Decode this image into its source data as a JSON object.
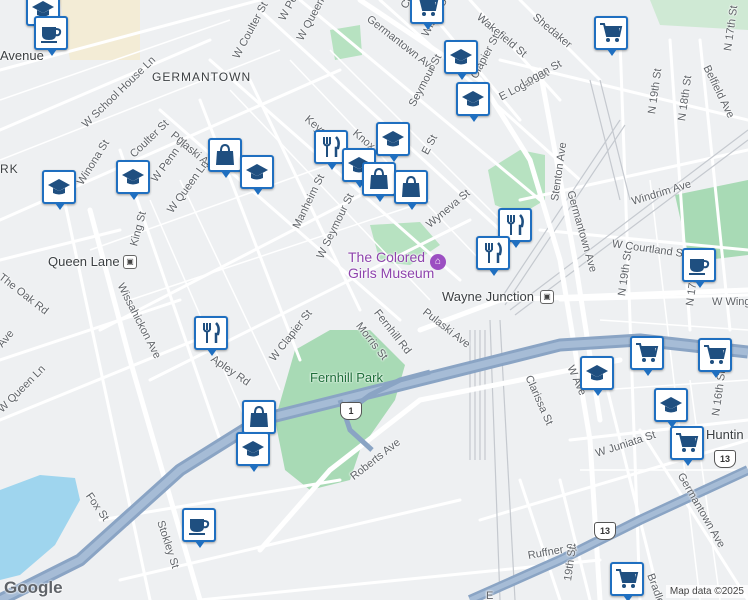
{
  "map": {
    "neighborhood_labels": [
      "GERMANTOWN",
      "RK"
    ],
    "poi_labels": {
      "museum_line1": "The Colored",
      "museum_line2": "Girls Museum",
      "queen_lane": "Queen Lane",
      "wayne_junction": "Wayne Junction",
      "fernhill_park": "Fernhill Park",
      "hunting": "Huntin",
      "avenue": "Avenue"
    },
    "streets": [
      "W Penn St",
      "W Queen Ln",
      "W Coulter St",
      "Germantown Ave",
      "Wister St",
      "Wakefield St",
      "Shedaker",
      "W School House Ln",
      "Coulter St",
      "W Penn St",
      "Pulaski Ave",
      "Winona St",
      "W Queen Ln",
      "King St",
      "Keyser",
      "Knox",
      "Manheim St",
      "W Seymour St",
      "Seymour St",
      "Clapier St",
      "E Logan St",
      "Wyneva St",
      "Stenton Ave",
      "Germantown Ave",
      "Windrim Ave",
      "W Courtland St",
      "N 19th St",
      "N 18th St",
      "Belfield Ave",
      "N 17th St",
      "N 16th St",
      "N 17th St",
      "W Wingo",
      "N 19th St",
      "Wissahickon Ave",
      "The Oak Rd",
      "Ave",
      "W Queen Ln",
      "W Clapier St",
      "Fernhill Rd",
      "Morris St",
      "Pulaski Ave",
      "Apley Rd",
      "Roberts Ave",
      "Clarissa St",
      "W Juniata St",
      "Germantown Ave",
      "Fox St",
      "Stokley St",
      "Ruffner St",
      "19th St",
      "Bradley St",
      "Co",
      "E St",
      "Logan St",
      "W Ave",
      "E"
    ],
    "route_shields": [
      "1",
      "13",
      "13"
    ],
    "markers": [
      {
        "type": "school"
      },
      {
        "type": "coffee"
      },
      {
        "type": "shopping-cart"
      },
      {
        "type": "school"
      },
      {
        "type": "school"
      },
      {
        "type": "shopping-cart"
      },
      {
        "type": "school"
      },
      {
        "type": "restaurant"
      },
      {
        "type": "school"
      },
      {
        "type": "shopping-bag"
      },
      {
        "type": "school"
      },
      {
        "type": "school"
      },
      {
        "type": "school"
      },
      {
        "type": "shopping-bag"
      },
      {
        "type": "shopping-bag"
      },
      {
        "type": "restaurant"
      },
      {
        "type": "restaurant"
      },
      {
        "type": "coffee"
      },
      {
        "type": "restaurant"
      },
      {
        "type": "shopping-cart"
      },
      {
        "type": "shopping-cart"
      },
      {
        "type": "school"
      },
      {
        "type": "school"
      },
      {
        "type": "shopping-bag"
      },
      {
        "type": "school"
      },
      {
        "type": "shopping-cart"
      },
      {
        "type": "coffee"
      },
      {
        "type": "shopping-cart"
      }
    ],
    "google_logo": "Google",
    "credit": "Map data ©2025"
  },
  "colors": {
    "background": "#eef0f2",
    "park": "#a8dab5",
    "water": "#9fd5ee",
    "highway": "#8aa4c4",
    "marker_border": "#1f6fc0",
    "museum": "#9c4fc2"
  }
}
